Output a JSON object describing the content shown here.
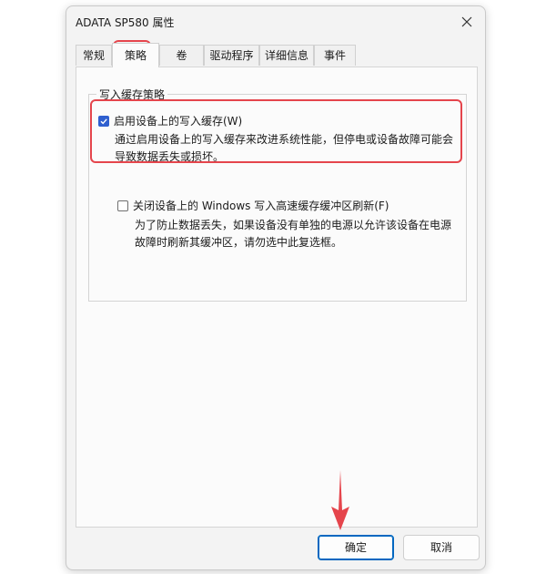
{
  "window": {
    "title": "ADATA SP580 属性"
  },
  "tabs": [
    {
      "label": "常规"
    },
    {
      "label": "策略"
    },
    {
      "label": "卷"
    },
    {
      "label": "驱动程序"
    },
    {
      "label": "详细信息"
    },
    {
      "label": "事件"
    }
  ],
  "active_tab": "策略",
  "policy": {
    "group_title": "写入缓存策略",
    "option1": {
      "label": "启用设备上的写入缓存(W)",
      "checked": true,
      "desc_line1": "通过启用设备上的写入缓存来改进系统性能，但停电或设备故障可能会",
      "desc_line2": "导致数据丢失或损坏。"
    },
    "option2": {
      "label": "关闭设备上的 Windows 写入高速缓存缓冲区刷新(F)",
      "checked": false,
      "desc_line1": "为了防止数据丢失，如果设备没有单独的电源以允许该设备在电源",
      "desc_line2": "故障时刷新其缓冲区，请勿选中此复选框。"
    }
  },
  "buttons": {
    "ok": "确定",
    "cancel": "取消"
  },
  "colors": {
    "accent": "#2f5fcf",
    "annotation": "#e5454c"
  },
  "icons": {
    "close": "close-icon",
    "check": "checkmark-icon",
    "annotation_arrow": "down-arrow-icon"
  }
}
